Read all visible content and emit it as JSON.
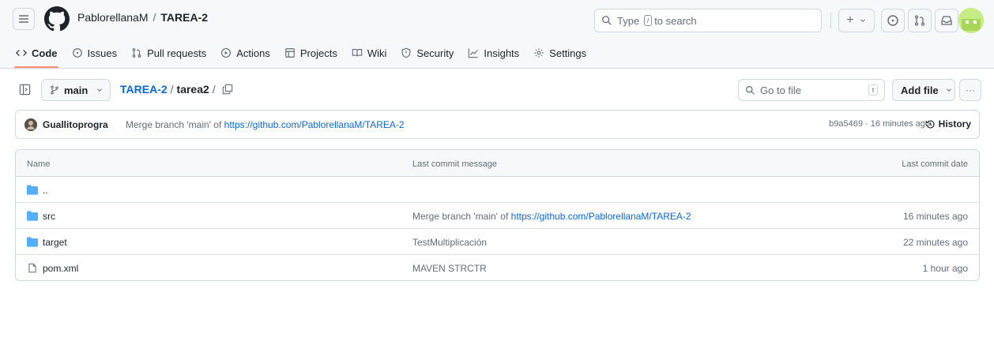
{
  "header": {
    "owner": "PablorellanaM",
    "separator": "/",
    "repo": "TAREA-2",
    "search_placeholder_pre": "Type",
    "search_key": "/",
    "search_placeholder_post": "to search",
    "plus_label": "+"
  },
  "tabs": [
    {
      "label": "Code",
      "icon": "code-icon",
      "active": true
    },
    {
      "label": "Issues",
      "icon": "issue-icon"
    },
    {
      "label": "Pull requests",
      "icon": "pull-request-icon"
    },
    {
      "label": "Actions",
      "icon": "play-icon"
    },
    {
      "label": "Projects",
      "icon": "table-icon"
    },
    {
      "label": "Wiki",
      "icon": "book-icon"
    },
    {
      "label": "Security",
      "icon": "shield-icon"
    },
    {
      "label": "Insights",
      "icon": "graph-icon"
    },
    {
      "label": "Settings",
      "icon": "gear-icon"
    }
  ],
  "toolbar": {
    "branch": "main",
    "path_root": "TAREA-2",
    "path_sep": "/",
    "path_current": "tarea2",
    "path_trailing_sep": "/",
    "goto_placeholder": "Go to file",
    "goto_key": "t",
    "add_file": "Add file",
    "more": "···"
  },
  "commit": {
    "author": "Guallitoprogra",
    "message_pre": "Merge branch 'main' of",
    "message_link": "https://github.com/PablorellanaM/TAREA-2",
    "hash_time": "b9a5469 · 16 minutes ago",
    "history": "History"
  },
  "table": {
    "headers": {
      "name": "Name",
      "message": "Last commit message",
      "date": "Last commit date"
    },
    "rows": [
      {
        "name": "..",
        "type": "folder",
        "message_pre": "",
        "message_link": "",
        "date": ""
      },
      {
        "name": "src",
        "type": "folder",
        "message_pre": "Merge branch 'main' of",
        "message_link": "https://github.com/PablorellanaM/TAREA-2",
        "date": "16 minutes ago"
      },
      {
        "name": "target",
        "type": "folder",
        "message_pre": "TestMultiplicación",
        "message_link": "",
        "date": "22 minutes ago"
      },
      {
        "name": "pom.xml",
        "type": "file",
        "message_pre": "MAVEN STRCTR",
        "message_link": "",
        "date": "1 hour ago"
      }
    ]
  },
  "colors": {
    "accent_link": "#0969da",
    "tab_underline": "#fd8c73",
    "folder": "#54aeff"
  }
}
